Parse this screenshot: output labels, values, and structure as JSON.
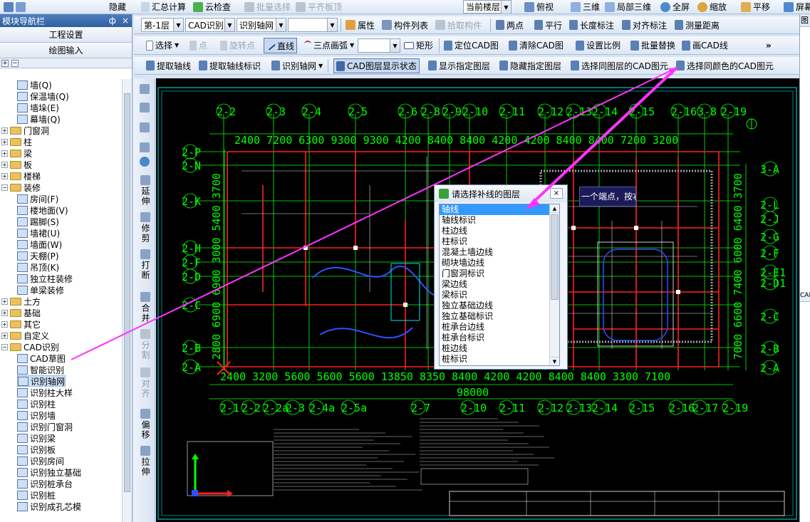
{
  "top_toolbar": {
    "items": [
      "隐藏",
      "汇总计算",
      "云检查",
      "批量选择",
      "平齐板顶"
    ],
    "floor_combo": "当前楼层",
    "right_items": [
      "俯视",
      "三维",
      "局部三维",
      "全屏",
      "缩放",
      "平移",
      "屏幕"
    ]
  },
  "nav": {
    "title": "模块导航栏",
    "pin": "ф",
    "close": "×",
    "btn_project": "工程设置",
    "btn_drawing": "绘图输入",
    "tree": [
      {
        "label": "墙(Q)",
        "level": 2
      },
      {
        "label": "保温墙(Q)",
        "level": 2
      },
      {
        "label": "墙垛(E)",
        "level": 2
      },
      {
        "label": "幕墙(Q)",
        "level": 2
      },
      {
        "label": "门窗洞",
        "level": 0,
        "exp": "+"
      },
      {
        "label": "柱",
        "level": 0,
        "exp": "+"
      },
      {
        "label": "梁",
        "level": 0,
        "exp": "+"
      },
      {
        "label": "板",
        "level": 0,
        "exp": "+"
      },
      {
        "label": "楼梯",
        "level": 0,
        "exp": "+"
      },
      {
        "label": "装修",
        "level": 0,
        "exp": "−"
      },
      {
        "label": "房间(F)",
        "level": 2
      },
      {
        "label": "楼地面(V)",
        "level": 2
      },
      {
        "label": "踢脚(S)",
        "level": 2
      },
      {
        "label": "墙裙(U)",
        "level": 2
      },
      {
        "label": "墙面(W)",
        "level": 2
      },
      {
        "label": "天棚(P)",
        "level": 2
      },
      {
        "label": "吊顶(K)",
        "level": 2
      },
      {
        "label": "独立柱装修",
        "level": 2
      },
      {
        "label": "单梁装修",
        "level": 2
      },
      {
        "label": "土方",
        "level": 0,
        "exp": "+"
      },
      {
        "label": "基础",
        "level": 0,
        "exp": "+"
      },
      {
        "label": "其它",
        "level": 0,
        "exp": "+"
      },
      {
        "label": "自定义",
        "level": 0,
        "exp": "+"
      },
      {
        "label": "CAD识别",
        "level": 0,
        "exp": "−"
      },
      {
        "label": "CAD草图",
        "level": 2
      },
      {
        "label": "智能识别",
        "level": 2
      },
      {
        "label": "识别轴网",
        "level": 2,
        "selected": true
      },
      {
        "label": "识别柱大样",
        "level": 2
      },
      {
        "label": "识别柱",
        "level": 2
      },
      {
        "label": "识别墙",
        "level": 2
      },
      {
        "label": "识别门窗洞",
        "level": 2
      },
      {
        "label": "识别梁",
        "level": 2
      },
      {
        "label": "识别板",
        "level": 2
      },
      {
        "label": "识别房间",
        "level": 2
      },
      {
        "label": "识别独立基础",
        "level": 2
      },
      {
        "label": "识别桩承台",
        "level": 2
      },
      {
        "label": "识别桩",
        "level": 2
      },
      {
        "label": "识别成孔芯模",
        "level": 2
      }
    ]
  },
  "row1": {
    "floor": "第-1层",
    "mode": "CAD识别",
    "sub": "识别轴网",
    "blank": "",
    "items": [
      "属性",
      "构件列表",
      "拾取构件",
      "两点",
      "平行",
      "长度标注",
      "对齐标注",
      "测量距离"
    ]
  },
  "row2": {
    "items": [
      "选择",
      "点",
      "旋转点",
      "直线",
      "三点画弧",
      "矩形",
      "定位CAD图",
      "清除CAD图",
      "设置比例",
      "批量替换",
      "画CAD线"
    ],
    "more": "»"
  },
  "row3": {
    "items": [
      "提取轴线",
      "提取轴线标识",
      "识别轴网",
      "CAD图层显示状态",
      "显示指定图层",
      "隐藏指定图层",
      "选择同图层的CAD图元",
      "选择同颜色的CAD图元"
    ]
  },
  "vtools": [
    "延伸",
    "修剪",
    "打断",
    "合并",
    "分割",
    "对齐",
    "偏移",
    "拉伸"
  ],
  "dialog": {
    "title": "请选择补线的图层",
    "close": "×",
    "selected_index": 0,
    "layers": [
      "轴线",
      "轴线标识",
      "柱边线",
      "柱标识",
      "混凝土墙边线",
      "砌块墙边线",
      "门窗洞标识",
      "梁边线",
      "梁标识",
      "独立基础边线",
      "独立基础标识",
      "桩承台边线",
      "桩承台标识",
      "桩边线",
      "桩标识"
    ]
  },
  "tooltip": "一个端点，按右",
  "cad": {
    "top_axes": [
      "2-2",
      "2-3",
      "2-4",
      "2-5",
      "2-6",
      "2-8",
      "2-9",
      "2-10",
      "2-11",
      "2-12",
      "2-13",
      "2-14",
      "2-15",
      "2-16",
      "3-8",
      "2-19"
    ],
    "bottom_axes": [
      "2-1",
      "2-2",
      "2-2a",
      "2-3",
      "2-4a",
      "2-5a",
      "2-7",
      "2-10",
      "2-11",
      "2-12",
      "2-13",
      "2-14",
      "2-15",
      "2-16",
      "2-17",
      "2-19"
    ],
    "left_axes": [
      "2-P",
      "2-N",
      "2-K",
      "2-H",
      "2-F",
      "2-D",
      "2-C",
      "2-B",
      "2-A"
    ],
    "right_axes": [
      "3-A",
      "2-L",
      "2-J",
      "2-G",
      "2-F",
      "2-E1",
      "2-D1",
      "2-C",
      "2-B",
      "2-A"
    ],
    "top_dims": "2400 7200 6300 9300 9300 4200 8400 8400 4200 4200 8400 8400 7200 3200",
    "bottom_dims": "2400 3200 5600 5600 5600 13850 8350 8400 4200 4200 8400 8400 3300 7100",
    "bottom_total": "98000",
    "left_dims": "2800 6900 6900 3000 5400 3700",
    "right_dims": "7000 6600 7400 6000 6400 3700"
  },
  "right_panel": {
    "tab": "图",
    "label": "CAD"
  },
  "colors": {
    "green": "#00ff00",
    "red": "#ff2020",
    "cyan": "#00e5e5",
    "magenta_arrow": "#ff33ff",
    "selection": "#3399ff"
  }
}
